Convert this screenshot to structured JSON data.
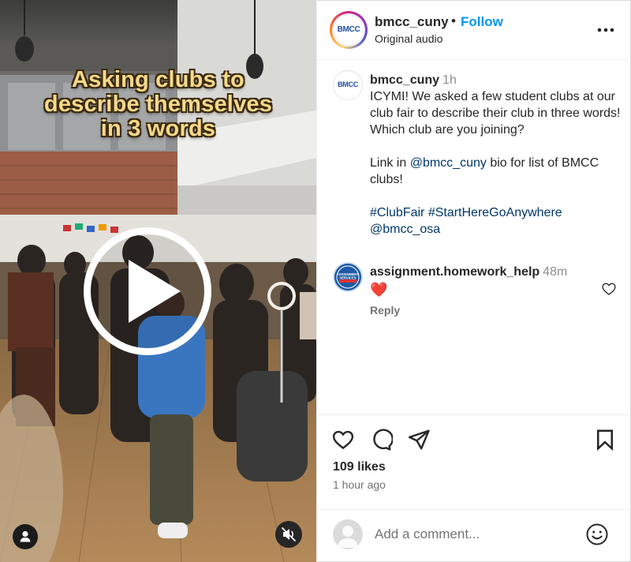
{
  "video": {
    "caption_lines": [
      "Asking clubs to",
      "describe themselves",
      "in 3 words"
    ],
    "play_icon": "play-icon",
    "tagged_users_icon": "person-icon",
    "mute_icon": "speaker-muted-icon"
  },
  "header": {
    "username": "bmcc_cuny",
    "separator": "•",
    "follow_label": "Follow",
    "audio_label": "Original audio",
    "logo_text": "BMCC",
    "more_icon": "more-options-icon"
  },
  "caption": {
    "username": "bmcc_cuny",
    "time": "1h",
    "text_1": "ICYMI! We asked a few student clubs at our club fair to describe their club in three words! Which club are you joining?",
    "link_prefix": "Link in ",
    "mention": "@bmcc_cuny",
    "link_suffix": " bio for list of BMCC clubs!",
    "hashtag_1": "#ClubFair",
    "hashtag_2": "#StartHereGoAnywhere",
    "mention_2": "@bmcc_osa"
  },
  "comment": {
    "username": "assignment.homework_help",
    "time": "48m",
    "text": "❤️",
    "reply_label": "Reply",
    "avatar_text_1": "ASSIGNMENT",
    "avatar_text_2": "SERVICES"
  },
  "actions": {
    "likes": "109 likes",
    "time_ago": "1 hour ago"
  },
  "add_comment": {
    "placeholder": "Add a comment..."
  },
  "colors": {
    "accent": "#0095f6",
    "link": "#00376b",
    "muted": "#737373",
    "heart": "#ed4956"
  }
}
